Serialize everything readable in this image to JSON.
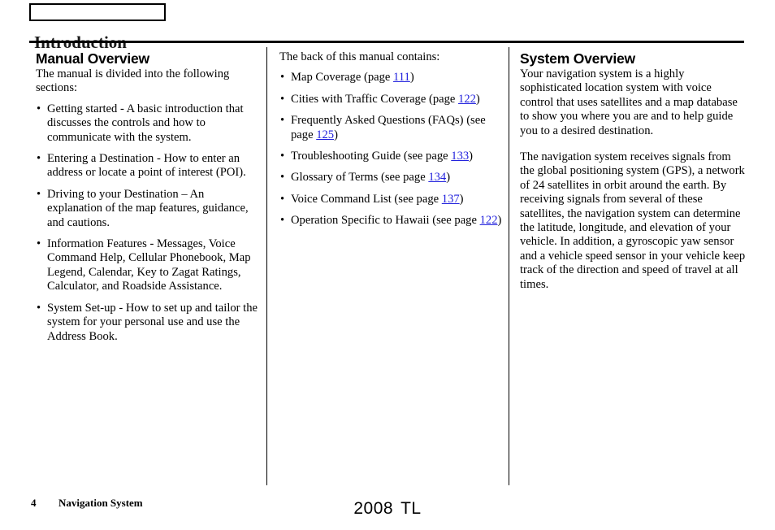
{
  "header": {
    "tab_box_label": "",
    "title": "Introduction"
  },
  "columns": {
    "left": {
      "heading": "Manual Overview",
      "intro": "The manual is divided into the following sections:",
      "bullet_marker": "•",
      "items": [
        "Getting started - A basic introduction that discusses the controls and how to communicate with the system.",
        "Entering a Destination - How to enter an address or locate a point of interest (POI).",
        "Driving to your Destination – An explanation of the map features, guidance, and cautions.",
        "Information Features - Messages, Voice Command Help, Cellular Phonebook, Map Legend, Calendar, Key to Zagat Ratings, Calculator, and Roadside Assistance.",
        "System Set-up - How to set up and tailor the system for your personal use and use the Address Book."
      ]
    },
    "middle": {
      "intro": "The back of this manual contains:",
      "bullet_marker": "•",
      "items": [
        {
          "prefix": "Map Coverage (page ",
          "page": "111",
          "suffix": ")"
        },
        {
          "prefix": "Cities with Traffic Coverage (page ",
          "page": "122",
          "suffix": ")"
        },
        {
          "prefix": "Frequently Asked Questions (FAQs) (see page ",
          "page": "125",
          "suffix": ")"
        },
        {
          "prefix": "Troubleshooting Guide (see page ",
          "page": "133",
          "suffix": ")"
        },
        {
          "prefix": "Glossary of Terms (see page ",
          "page": "134",
          "suffix": ")"
        },
        {
          "prefix": "Voice Command List (see page ",
          "page": "137",
          "suffix": ")"
        },
        {
          "prefix": "Operation Specific to Hawaii (see page ",
          "page": "122",
          "suffix": ")"
        }
      ]
    },
    "right": {
      "heading": "System Overview",
      "paragraph1": "Your navigation system is a highly sophisticated location system with voice control that uses satellites and a map database to show you where you are and to help guide you to a desired destination.",
      "paragraph2": "The navigation system receives signals from the global positioning system (GPS), a network of 24 satellites in orbit around the earth. By receiving signals from several of these satellites, the navigation system can determine the latitude, longitude, and elevation of your vehicle. In addition, a gyroscopic yaw sensor and a vehicle speed sensor in your vehicle keep track of the direction and speed of travel at all times."
    }
  },
  "footer": {
    "page_number": "4",
    "label": "Navigation System",
    "model_year": "2008",
    "model_name": "TL"
  },
  "colors": {
    "link": "#2222dd",
    "text": "#000000",
    "rule": "#000000"
  }
}
